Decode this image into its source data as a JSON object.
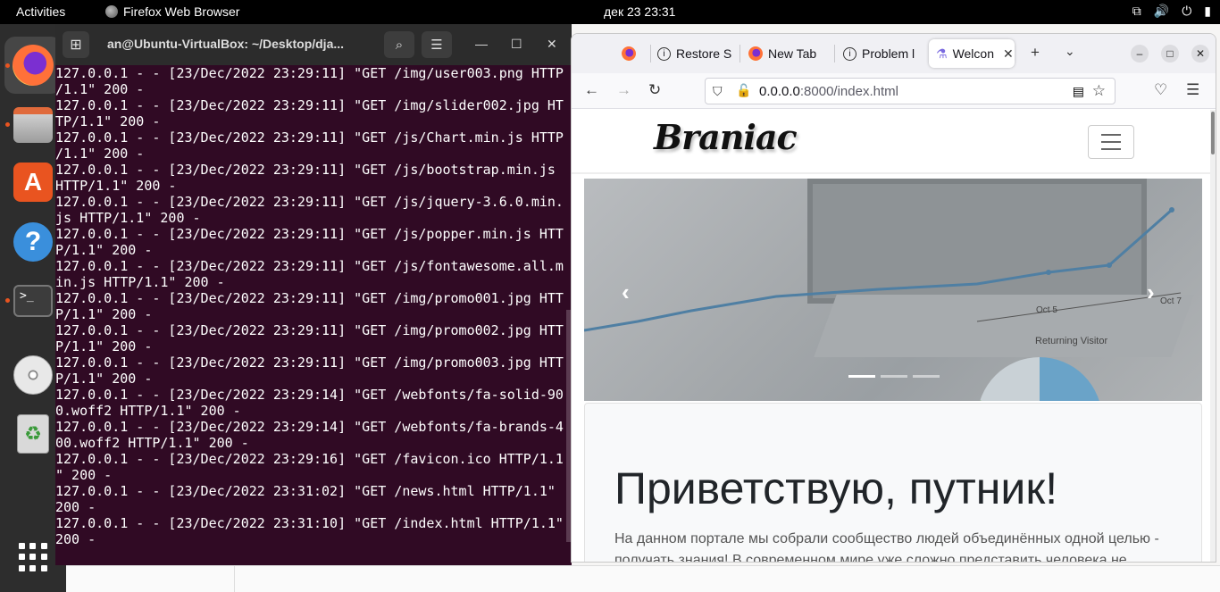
{
  "topbar": {
    "activities": "Activities",
    "app": "Firefox Web Browser",
    "clock": "дек 23  23:31"
  },
  "dock": {
    "items": [
      "firefox",
      "files",
      "software",
      "help",
      "terminal",
      "dvd",
      "trash",
      "apps"
    ]
  },
  "terminal": {
    "title": "an@Ubuntu-VirtualBox: ~/Desktop/dja...",
    "lines": [
      "127.0.0.1 - - [23/Dec/2022 23:29:11] \"GET /img/user003.png HTTP",
      "/1.1\" 200 -",
      "127.0.0.1 - - [23/Dec/2022 23:29:11] \"GET /img/slider002.jpg HT",
      "TP/1.1\" 200 -",
      "127.0.0.1 - - [23/Dec/2022 23:29:11] \"GET /js/Chart.min.js HTTP",
      "/1.1\" 200 -",
      "127.0.0.1 - - [23/Dec/2022 23:29:11] \"GET /js/bootstrap.min.js ",
      "HTTP/1.1\" 200 -",
      "127.0.0.1 - - [23/Dec/2022 23:29:11] \"GET /js/jquery-3.6.0.min.",
      "js HTTP/1.1\" 200 -",
      "127.0.0.1 - - [23/Dec/2022 23:29:11] \"GET /js/popper.min.js HTT",
      "P/1.1\" 200 -",
      "127.0.0.1 - - [23/Dec/2022 23:29:11] \"GET /js/fontawesome.all.m",
      "in.js HTTP/1.1\" 200 -",
      "127.0.0.1 - - [23/Dec/2022 23:29:11] \"GET /img/promo001.jpg HTT",
      "P/1.1\" 200 -",
      "127.0.0.1 - - [23/Dec/2022 23:29:11] \"GET /img/promo002.jpg HTT",
      "P/1.1\" 200 -",
      "127.0.0.1 - - [23/Dec/2022 23:29:11] \"GET /img/promo003.jpg HTT",
      "P/1.1\" 200 -",
      "127.0.0.1 - - [23/Dec/2022 23:29:14] \"GET /webfonts/fa-solid-90",
      "0.woff2 HTTP/1.1\" 200 -",
      "127.0.0.1 - - [23/Dec/2022 23:29:14] \"GET /webfonts/fa-brands-4",
      "00.woff2 HTTP/1.1\" 200 -",
      "127.0.0.1 - - [23/Dec/2022 23:29:16] \"GET /favicon.ico HTTP/1.1",
      "\" 200 -",
      "127.0.0.1 - - [23/Dec/2022 23:31:02] \"GET /news.html HTTP/1.1\"",
      "200 -",
      "127.0.0.1 - - [23/Dec/2022 23:31:10] \"GET /index.html HTTP/1.1\"",
      "200 -"
    ]
  },
  "browser": {
    "tabs": [
      {
        "label": ""
      },
      {
        "label": "Restore S"
      },
      {
        "label": "New Tab"
      },
      {
        "label": "Problem l"
      },
      {
        "label": "Welcon"
      }
    ],
    "url_host": "0.0.0.0",
    "url_rest": ":8000/index.html"
  },
  "site": {
    "logo": "Braniac",
    "carousel": {
      "prev": "‹",
      "next": "›",
      "chart_labels": [
        "Oct 5",
        "Oct 7",
        "Returning Visitor"
      ]
    },
    "heading": "Приветствую, путник!",
    "lead": "На данном портале мы собрали сообщество людей объединённых одной целью - получать знания! В современном мире уже сложно представить человека не"
  }
}
